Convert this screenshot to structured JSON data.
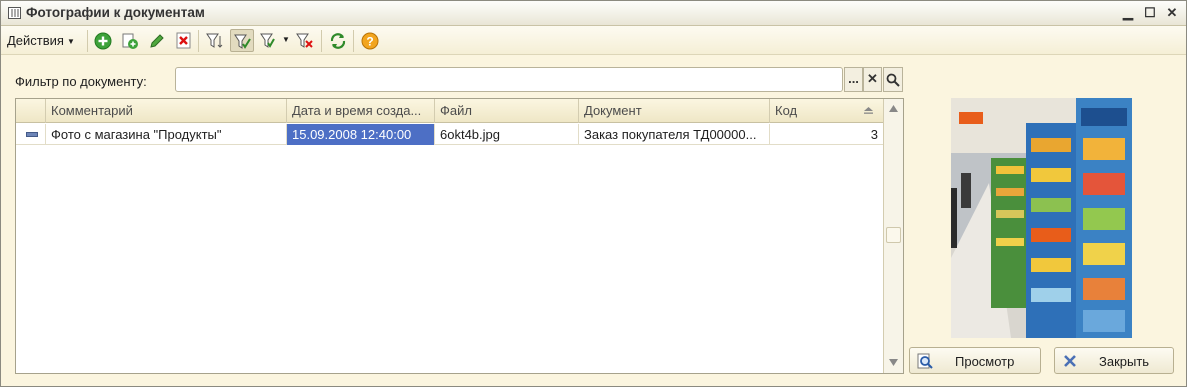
{
  "window": {
    "title": "Фотографии к документам"
  },
  "toolbar": {
    "actions_label": "Действия",
    "icons": [
      "add-icon",
      "copy-icon",
      "edit-icon",
      "delete-icon",
      "filter-settings-icon",
      "filter-by-value-icon",
      "filter-history-icon",
      "clear-filter-icon",
      "refresh-icon",
      "help-icon"
    ]
  },
  "filter": {
    "label": "Фильтр по документу:",
    "value": "",
    "select_label": "...",
    "clear_label": "✕"
  },
  "table": {
    "columns": [
      "Комментарий",
      "Дата и время созда...",
      "Файл",
      "Документ",
      "Код"
    ],
    "rows": [
      {
        "comment": "Фото с магазина \"Продукты\"",
        "datetime": "15.09.2008 12:40:00",
        "file": "6okt4b.jpg",
        "document": "Заказ покупателя ТД00000...",
        "code": "3"
      }
    ]
  },
  "buttons": {
    "preview": "Просмотр",
    "close": "Закрыть"
  },
  "colors": {
    "accent": "#4d6fc5",
    "background": "#fbf5df"
  }
}
